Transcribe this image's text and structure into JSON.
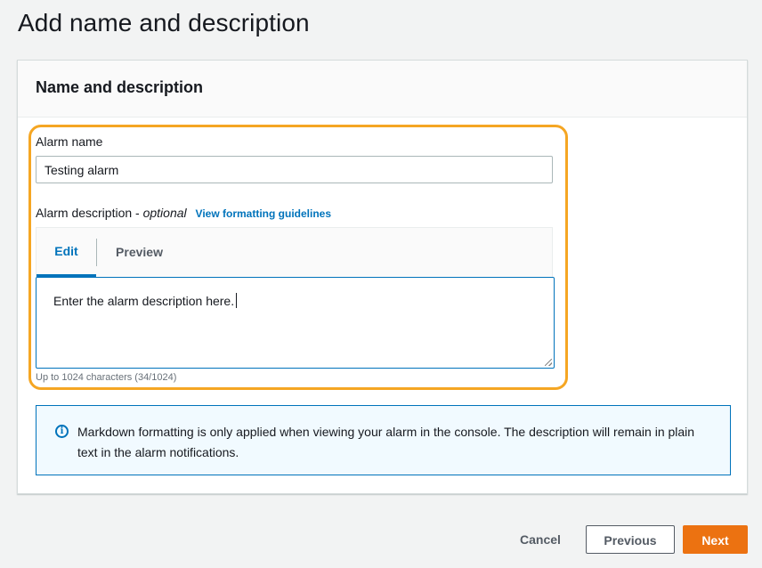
{
  "page": {
    "title": "Add name and description"
  },
  "panel": {
    "title": "Name and description"
  },
  "alarm_name": {
    "label": "Alarm name",
    "value": "Testing alarm"
  },
  "alarm_description": {
    "label": "Alarm description - ",
    "optional_label": "optional",
    "guidelines_link": "View formatting guidelines",
    "tabs": [
      {
        "label": "Edit",
        "selected": true
      },
      {
        "label": "Preview",
        "selected": false
      }
    ],
    "value": "Enter the alarm description here.",
    "char_count": "Up to 1024 characters (34/1024)"
  },
  "info": {
    "icon": "info-icon",
    "text": "Markdown formatting is only applied when viewing your alarm in the console. The description will remain in plain text in the alarm notifications."
  },
  "footer": {
    "cancel_label": "Cancel",
    "previous_label": "Previous",
    "next_label": "Next"
  },
  "colors": {
    "accent_blue": "#0073bb",
    "primary_orange": "#ec7211",
    "highlight_orange": "#f5a623"
  }
}
